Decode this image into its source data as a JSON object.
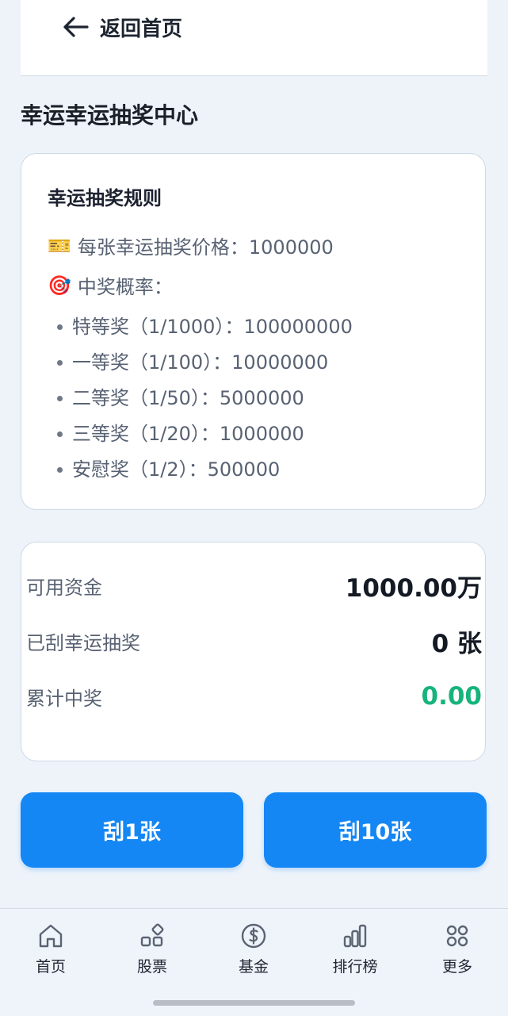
{
  "header": {
    "back_label": "返回首页"
  },
  "page_title": "幸运幸运抽奖中心",
  "rules": {
    "title": "幸运抽奖规则",
    "price_icon": "🎫",
    "price_text": "每张幸运抽奖价格：1000000",
    "prob_icon": "🎯",
    "prob_text": "中奖概率：",
    "prizes": [
      "特等奖（1/1000）：100000000",
      "一等奖（1/100）：10000000",
      "二等奖（1/50）：5000000",
      "三等奖（1/20）：1000000",
      "安慰奖（1/2）：500000"
    ]
  },
  "stats": {
    "available_label": "可用资金",
    "available_value": "1000.00万",
    "scratched_label": "已刮幸运抽奖",
    "scratched_value": "0 张",
    "total_win_label": "累计中奖",
    "total_win_value": "0.00"
  },
  "actions": {
    "scratch_one": "刮1张",
    "scratch_ten": "刮10张"
  },
  "nav": {
    "home": "首页",
    "stock": "股票",
    "fund": "基金",
    "rank": "排行榜",
    "more": "更多"
  },
  "colors": {
    "accent": "#1487f4",
    "win_green": "#16b47c",
    "background": "#eef3fa"
  }
}
